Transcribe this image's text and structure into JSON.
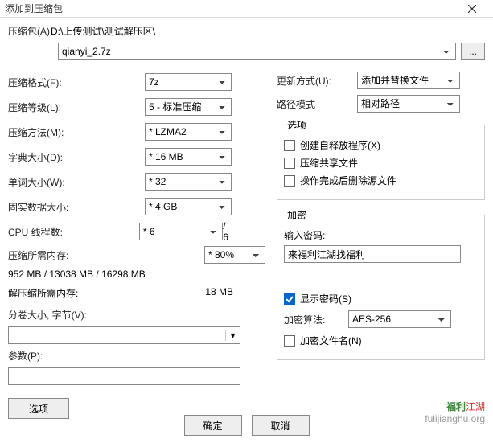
{
  "title": "添加到压缩包",
  "archive_label": "压缩包(A)",
  "path_display": "D:\\上传测试\\测试解压区\\",
  "archive_name": "qianyi_2.7z",
  "browse": "...",
  "left": {
    "format_label": "压缩格式(F):",
    "format_value": "7z",
    "level_label": "压缩等级(L):",
    "level_value": "5 - 标准压缩",
    "method_label": "压缩方法(M):",
    "method_value": "LZMA2",
    "dict_label": "字典大小(D):",
    "dict_value": "16 MB",
    "word_label": "单词大小(W):",
    "word_value": "32",
    "solid_label": "固实数据大小:",
    "solid_value": "4 GB",
    "cpu_label": "CPU 线程数:",
    "cpu_value": "6",
    "cpu_max": "/ 6",
    "compmem_label": "压缩所需内存:",
    "compmem_percent": "80%",
    "compmem_detail": "952 MB / 13038 MB / 16298 MB",
    "decompmem_label": "解压缩所需内存:",
    "decompmem_value": "18 MB",
    "volume_label": "分卷大小, 字节(V):",
    "param_label": "参数(P):",
    "options_btn": "选项"
  },
  "right": {
    "update_label": "更新方式(U):",
    "update_value": "添加并替换文件",
    "pathmode_label": "路径模式",
    "pathmode_value": "相对路径",
    "options_legend": "选项",
    "sfx": "创建自释放程序(X)",
    "shared": "压缩共享文件",
    "delete_after": "操作完成后删除源文件",
    "enc_legend": "加密",
    "pw_label": "输入密码:",
    "pw_value": "来福利江湖找福利",
    "show_pw": "显示密码(S)",
    "enc_method_label": "加密算法:",
    "enc_method_value": "AES-256",
    "enc_names": "加密文件名(N)"
  },
  "buttons": {
    "ok": "确定",
    "cancel": "取消"
  },
  "watermark": {
    "logo1": "福利",
    "logo2": "江湖",
    "url": "fulijianghu.org"
  }
}
